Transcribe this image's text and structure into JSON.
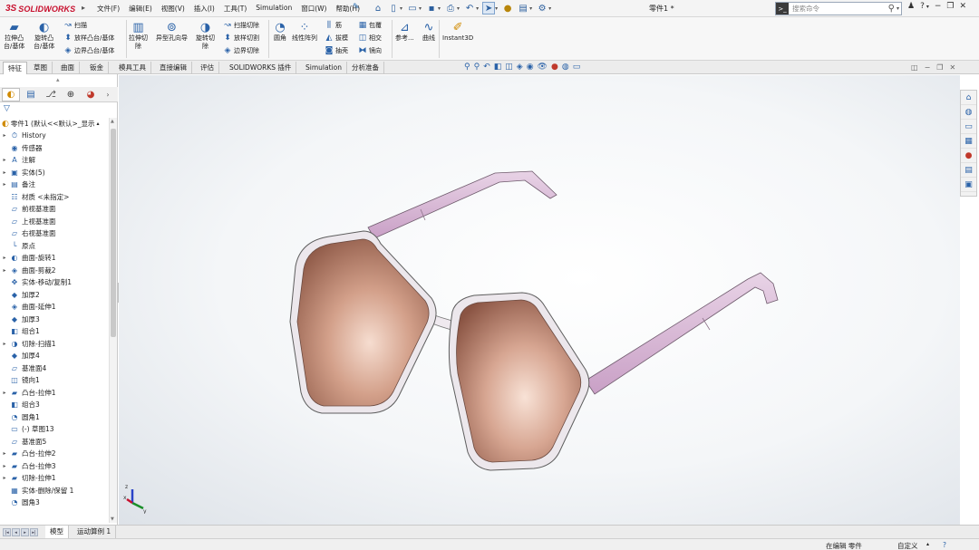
{
  "app": {
    "logo_prefix": "3S",
    "logo_text": "SOLIDWORKS",
    "doc_title": "零件1 *"
  },
  "menu": [
    "文件(F)",
    "编辑(E)",
    "视图(V)",
    "插入(I)",
    "工具(T)",
    "Simulation",
    "窗口(W)",
    "帮助(H)"
  ],
  "search": {
    "placeholder": "搜索命令"
  },
  "help": {
    "label": "?"
  },
  "commands": {
    "extrude_boss": "拉伸凸\n台/基体",
    "revolve_boss": "旋转凸\n台/基体",
    "sweep": "扫描",
    "loft": "放样凸台/基体",
    "boundary_boss": "边界凸台/基体",
    "extrude_cut": "拉伸切\n除",
    "hole_wizard": "异型孔向导",
    "revolve_cut": "旋转切\n除",
    "swept_cut": "扫描切除",
    "lofted_cut": "放样切割",
    "boundary_cut": "边界切除",
    "fillet": "圆角",
    "linear_pattern": "线性阵列",
    "rib": "筋",
    "draft": "拔模",
    "shell": "抽壳",
    "wrap": "包覆",
    "intersect": "相交",
    "mirror": "镜向",
    "ref_geometry": "参考...",
    "curves": "曲线",
    "instant3d": "Instant3D"
  },
  "tabs": [
    "特征",
    "草图",
    "曲面",
    "钣金",
    "模具工具",
    "直接编辑",
    "评估",
    "SOLIDWORKS 插件",
    "Simulation",
    "分析准备"
  ],
  "tree": {
    "root": "零件1 (默认<<默认>_显示",
    "items": [
      {
        "label": "History",
        "icon": "history-icon",
        "glyph": "⏱",
        "expand": true
      },
      {
        "label": "传感器",
        "icon": "sensor-icon",
        "glyph": "◉",
        "expand": false
      },
      {
        "label": "注解",
        "icon": "annotation-icon",
        "glyph": "A",
        "expand": true
      },
      {
        "label": "实体(5)",
        "icon": "solid-bodies-icon",
        "glyph": "▣",
        "expand": true
      },
      {
        "label": "备注",
        "icon": "notes-icon",
        "glyph": "▤",
        "expand": true
      },
      {
        "label": "材质 <未指定>",
        "icon": "material-icon",
        "glyph": "☷",
        "expand": false
      },
      {
        "label": "前视基准面",
        "icon": "plane-icon",
        "glyph": "▱",
        "expand": false
      },
      {
        "label": "上视基准面",
        "icon": "plane-icon",
        "glyph": "▱",
        "expand": false
      },
      {
        "label": "右视基准面",
        "icon": "plane-icon",
        "glyph": "▱",
        "expand": false
      },
      {
        "label": "原点",
        "icon": "origin-icon",
        "glyph": "└",
        "expand": false
      },
      {
        "label": "曲面-旋转1",
        "icon": "surface-revolve-icon",
        "glyph": "◐",
        "expand": true
      },
      {
        "label": "曲面-剪裁2",
        "icon": "surface-trim-icon",
        "glyph": "◈",
        "expand": true
      },
      {
        "label": "实体-移动/复制1",
        "icon": "move-copy-icon",
        "glyph": "✥",
        "expand": false
      },
      {
        "label": "加厚2",
        "icon": "thicken-icon",
        "glyph": "◆",
        "expand": false
      },
      {
        "label": "曲面-延伸1",
        "icon": "surface-extend-icon",
        "glyph": "◈",
        "expand": false
      },
      {
        "label": "加厚3",
        "icon": "thicken-icon",
        "glyph": "◆",
        "expand": false
      },
      {
        "label": "组合1",
        "icon": "combine-icon",
        "glyph": "◧",
        "expand": false
      },
      {
        "label": "切除-扫描1",
        "icon": "swept-cut-icon",
        "glyph": "◑",
        "expand": true
      },
      {
        "label": "加厚4",
        "icon": "thicken-icon",
        "glyph": "◆",
        "expand": false
      },
      {
        "label": "基准面4",
        "icon": "plane-icon",
        "glyph": "▱",
        "expand": false
      },
      {
        "label": "镜向1",
        "icon": "mirror-icon",
        "glyph": "◫",
        "expand": false
      },
      {
        "label": "凸台-拉伸1",
        "icon": "extrude-icon",
        "glyph": "▰",
        "expand": true
      },
      {
        "label": "组合3",
        "icon": "combine-icon",
        "glyph": "◧",
        "expand": false
      },
      {
        "label": "圆角1",
        "icon": "fillet-icon",
        "glyph": "◔",
        "expand": false
      },
      {
        "label": "(-) 草图13",
        "icon": "sketch-icon",
        "glyph": "▭",
        "expand": false
      },
      {
        "label": "基准面5",
        "icon": "plane-icon",
        "glyph": "▱",
        "expand": false
      },
      {
        "label": "凸台-拉伸2",
        "icon": "extrude-icon",
        "glyph": "▰",
        "expand": true
      },
      {
        "label": "凸台-拉伸3",
        "icon": "extrude-icon",
        "glyph": "▰",
        "expand": true
      },
      {
        "label": "切除-拉伸1",
        "icon": "cut-extrude-icon",
        "glyph": "▰",
        "expand": true
      },
      {
        "label": "实体-删除/保留 1",
        "icon": "delete-body-icon",
        "glyph": "▦",
        "expand": false
      },
      {
        "label": "圆角3",
        "icon": "fillet-icon",
        "glyph": "◔",
        "expand": false
      }
    ]
  },
  "bottom_tabs": [
    "模型",
    "运动算例 1"
  ],
  "status": {
    "editing": "在编辑 零件",
    "custom": "自定义"
  },
  "colors": {
    "brand": "#c8102e",
    "accent": "#2a62a8",
    "frame": "#d7b6d6",
    "lens": "#b87c62"
  }
}
